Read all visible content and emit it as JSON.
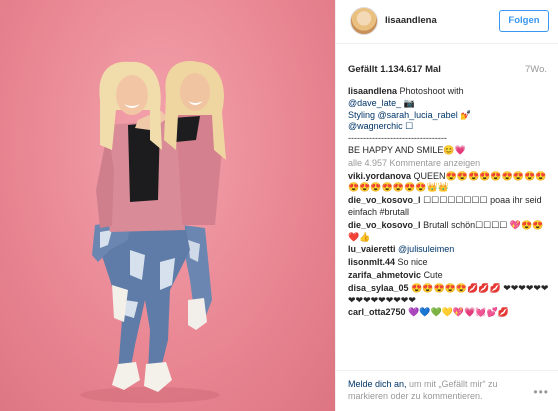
{
  "post": {
    "username": "lisaandlena",
    "follow_label": "Folgen",
    "likes": "Gefällt 1.134.617 Mal",
    "time": "7Wo.",
    "caption_user": "lisaandlena",
    "caption_lines": [
      "Photoshoot with",
      "@dave_late_ 📷",
      "Styling @sarah_lucia_rabel 💅",
      "@wagnerchic ☐",
      "---------------------------------",
      "BE HAPPY AND SMILE😊💗"
    ],
    "view_all": "alle 4.957 Kommentare anzeigen"
  },
  "comments": [
    {
      "user": "viki.yordanova",
      "text": "QUEEN😍😍😍😍😍😍😍😍😍😍😍😍😍😍😍😍👑👑"
    },
    {
      "user": "die_vo_kosovo_l",
      "text": "☐☐☐☐☐☐☐☐ poaa ihr seid einfach #brutall"
    },
    {
      "user": "die_vo_kosovo_l",
      "text": "Brutall schön☐☐☐☐ 💖😍😍❤️👍"
    },
    {
      "user": "lu_vaieretti",
      "text": "@julisuleimen"
    },
    {
      "user": "lisonmlt.44",
      "text": "So nice"
    },
    {
      "user": "zarifa_ahmetovic",
      "text": "Cute"
    },
    {
      "user": "disa_sylaa_05",
      "text": "😍😍😍😍😍💋💋💋 ❤❤❤❤❤❤❤❤❤❤❤❤❤❤❤"
    },
    {
      "user": "carl_otta2750",
      "text": "💜💙💚💛💖💗💓💕💋"
    }
  ],
  "footer": {
    "login_link": "Melde dich an,",
    "text": " um mit „Gefällt mir“ zu markieren oder zu kommentieren.",
    "more_icon": "ellipsis-icon"
  },
  "colors": {
    "photo_background": "#e98793",
    "follow_blue": "#3897f0",
    "link_blue": "#003569"
  }
}
